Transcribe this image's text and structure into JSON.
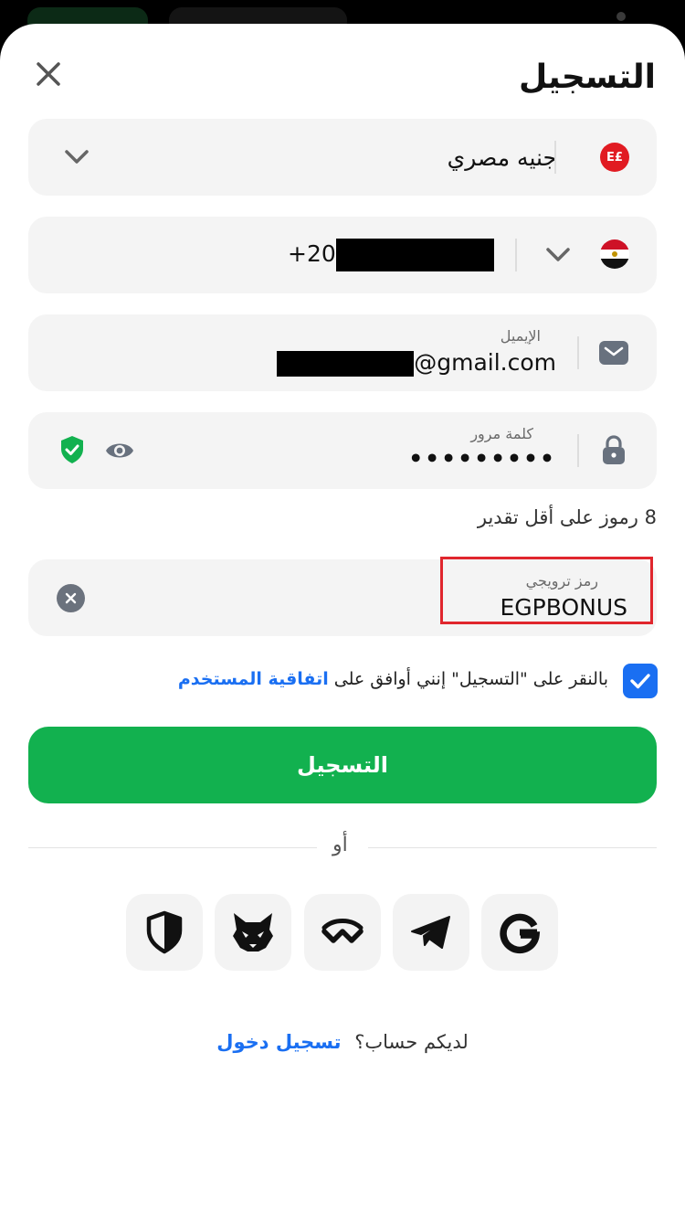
{
  "page": {
    "title": "التسجيل"
  },
  "currency": {
    "value": "جنيه مصري",
    "badge": "E£",
    "icon": "currency-badge-icon"
  },
  "phone": {
    "value": "+20",
    "flag": "egypt-flag-icon"
  },
  "email": {
    "label": "الإيميل",
    "value": "@gmail.com"
  },
  "password": {
    "label": "كلمة مرور",
    "value": "•••••••••"
  },
  "password_hint": "8 رموز على أقل تقدير",
  "promo": {
    "label": "رمز ترويجي",
    "value": "EGPBONUS"
  },
  "agreement": {
    "checked": true,
    "text": "بالنقر على \"التسجيل\" إنني أوافق على",
    "link": "اتفاقية المستخدم"
  },
  "submit_label": "التسجيل",
  "or_label": "أو",
  "social_icons": [
    "shield-icon",
    "metamask-fox-icon",
    "walletconnect-icon",
    "telegram-icon",
    "google-icon"
  ],
  "footer": {
    "question": "لديكم حساب؟",
    "login_link": "تسجيل دخول"
  },
  "colors": {
    "accent": "#1a6ff2",
    "primary_button": "#12b14f",
    "field_bg": "#f4f4f4",
    "highlight": "#e0262d"
  }
}
